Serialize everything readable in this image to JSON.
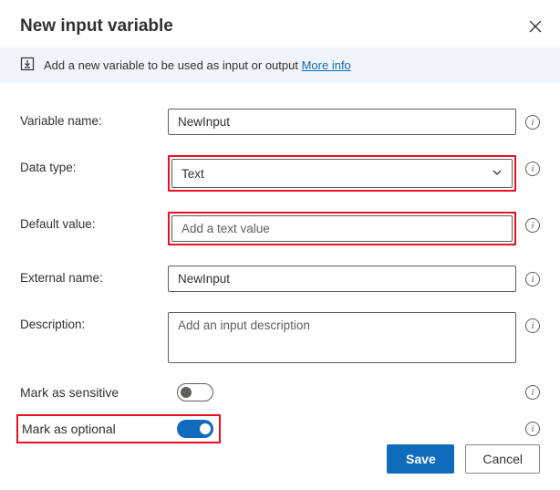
{
  "dialog": {
    "title": "New input variable",
    "banner_text": "Add a new variable to be used as input or output ",
    "banner_link": "More info"
  },
  "fields": {
    "var_name": {
      "label": "Variable name:",
      "value": "NewInput"
    },
    "data_type": {
      "label": "Data type:",
      "value": "Text"
    },
    "default_value": {
      "label": "Default value:",
      "placeholder": "Add a text value",
      "value": ""
    },
    "external_name": {
      "label": "External name:",
      "value": "NewInput"
    },
    "description": {
      "label": "Description:",
      "placeholder": "Add an input description",
      "value": ""
    },
    "mark_sensitive": {
      "label": "Mark as sensitive",
      "value": false
    },
    "mark_optional": {
      "label": "Mark as optional",
      "value": true
    }
  },
  "buttons": {
    "save": "Save",
    "cancel": "Cancel"
  }
}
